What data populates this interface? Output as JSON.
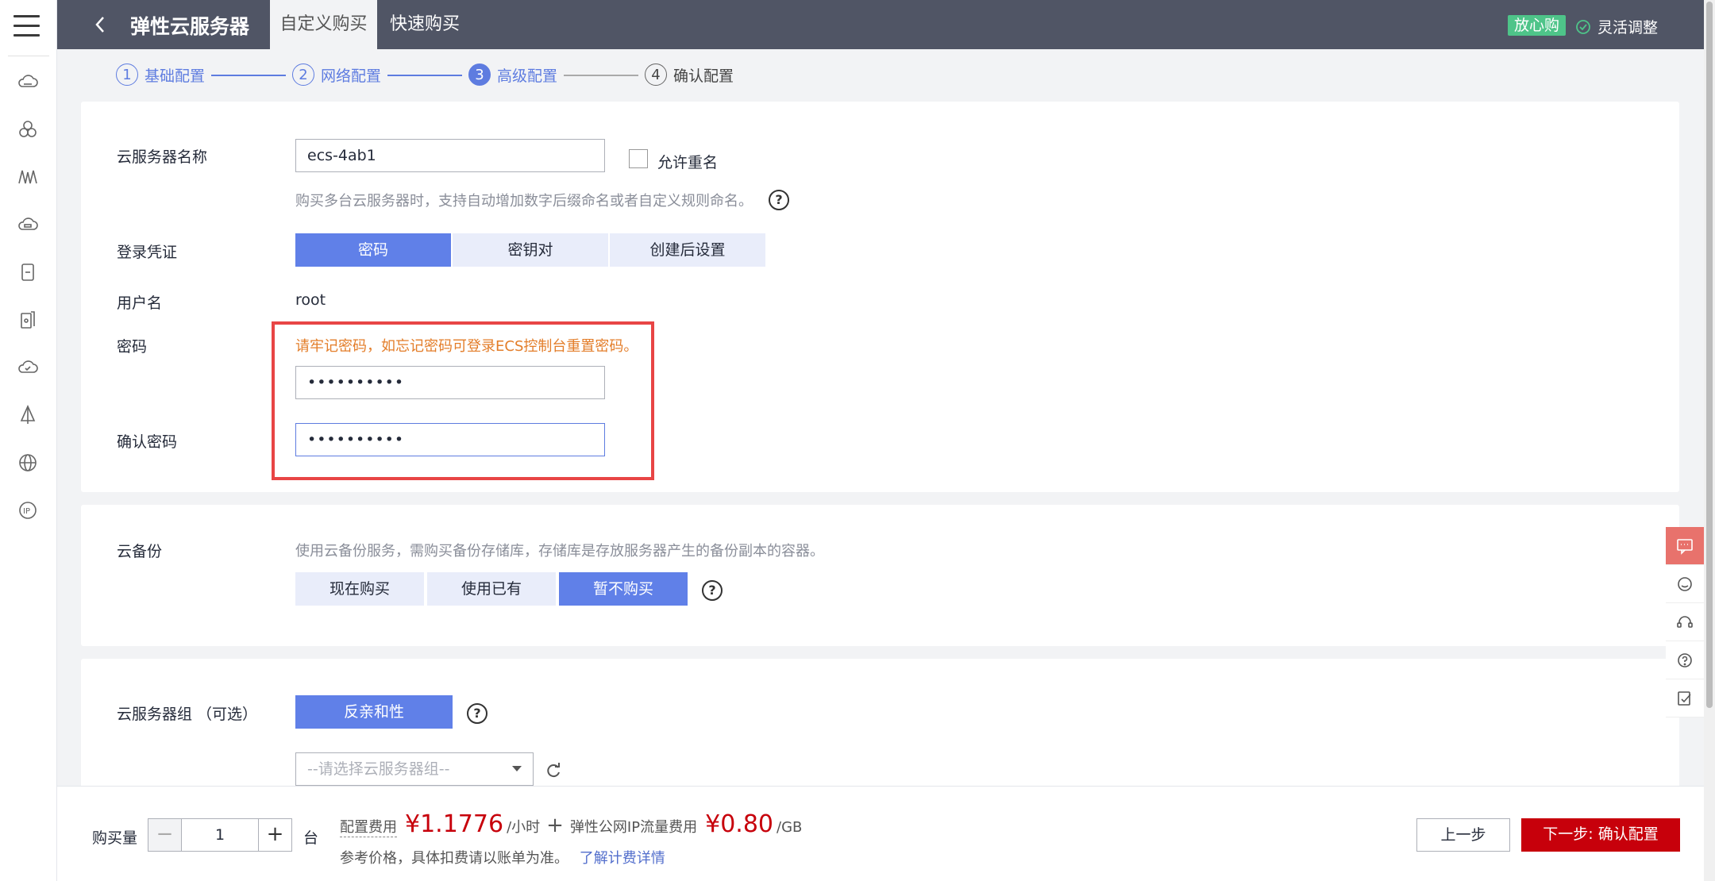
{
  "topbar": {
    "title": "弹性云服务器",
    "tabs": [
      "自定义购买",
      "快速购买"
    ],
    "badge": "放心购",
    "flex_adjust": "灵活调整"
  },
  "steps": [
    {
      "num": "1",
      "label": "基础配置"
    },
    {
      "num": "2",
      "label": "网络配置"
    },
    {
      "num": "3",
      "label": "高级配置"
    },
    {
      "num": "4",
      "label": "确认配置"
    }
  ],
  "server_name": {
    "label": "云服务器名称",
    "value": "ecs-4ab1",
    "allow_dup_label": "允许重名",
    "hint": "购买多台云服务器时，支持自动增加数字后缀命名或者自定义规则命名。"
  },
  "login": {
    "label": "登录凭证",
    "options": [
      "密码",
      "密钥对",
      "创建后设置"
    ],
    "selected": "密码"
  },
  "username": {
    "label": "用户名",
    "value": "root"
  },
  "password": {
    "label": "密码",
    "warning": "请牢记密码，如忘记密码可登录ECS控制台重置密码。",
    "value": "••••••••••",
    "confirm_label": "确认密码",
    "confirm_value": "••••••••••"
  },
  "backup": {
    "label": "云备份",
    "hint": "使用云备份服务，需购买备份存储库，存储库是存放服务器产生的备份副本的容器。",
    "options": [
      "现在购买",
      "使用已有",
      "暂不购买"
    ],
    "selected": "暂不购买"
  },
  "server_group": {
    "label": "云服务器组 （可选）",
    "policy": "反亲和性",
    "select_placeholder": "--请选择云服务器组--"
  },
  "bottom": {
    "qty_label": "购买量",
    "qty_value": "1",
    "qty_unit": "台",
    "fee_label": "配置费用",
    "fee_value": "¥1.1776",
    "fee_unit": "/小时",
    "plus": "+",
    "ip_fee_label": "弹性公网IP流量费用",
    "ip_fee_value": "¥0.80",
    "ip_fee_unit": "/GB",
    "note": "参考价格，具体扣费请以账单为准。",
    "note_link": "了解计费详情",
    "prev": "上一步",
    "next": "下一步: 确认配置"
  },
  "colors": {
    "accent": "#5e7ce0",
    "danger": "#c7000b",
    "warning": "#e37d29",
    "highlight": "#e84545"
  }
}
